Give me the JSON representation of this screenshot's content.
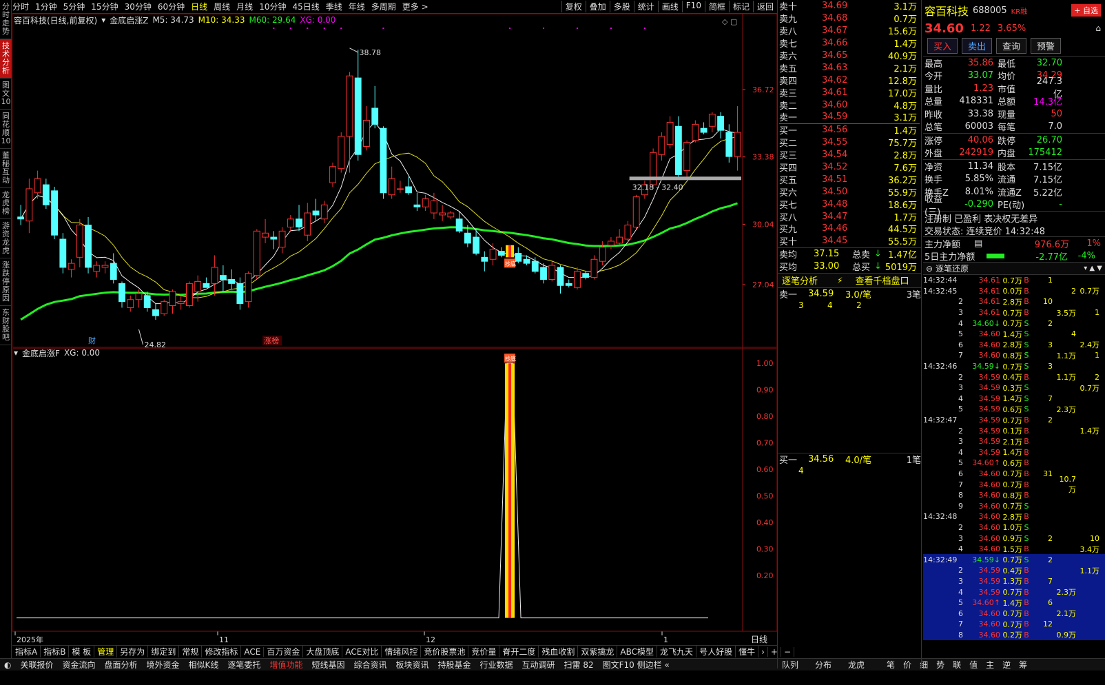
{
  "left_tabs": [
    "分时走势",
    "技术分析",
    "图文10",
    "同花顺10",
    "董秘互动",
    "龙虎榜",
    "游资龙虎",
    "涨跌停原因",
    "东财股吧"
  ],
  "top_periods": [
    "分时",
    "1分钟",
    "5分钟",
    "15分钟",
    "30分钟",
    "60分钟",
    "日线",
    "周线",
    "月线",
    "10分钟",
    "45日线",
    "季线",
    "年线",
    "多周期",
    "更多 >"
  ],
  "top_active": "日线",
  "top_right": [
    "复权",
    "叠加",
    "多股",
    "统计",
    "画线",
    "F10",
    "简框",
    "标记",
    "返回"
  ],
  "title": {
    "stock": "容百科技(日线,前复权)",
    "ind": "金底启涨Z",
    "m5": "M5: 34.73",
    "m10": "M10: 34.33",
    "m60": "M60: 29.64",
    "xg": "XG: 0.00"
  },
  "sub_title": {
    "ind": "金底启涨F",
    "xg": "XG: 0.00"
  },
  "chart_labels": {
    "high": "38.78",
    "low": "24.82",
    "range": "32.18 - 32.40",
    "cai": "财",
    "zhangbang": "涨榜",
    "signal": "抄底"
  },
  "price_axis": [
    "36.72",
    "33.38",
    "30.04",
    "27.04"
  ],
  "sub_axis": [
    "1.00",
    "0.90",
    "0.80",
    "0.70",
    "0.60",
    "0.50",
    "0.40",
    "0.30",
    "0.20"
  ],
  "x_axis": [
    "2025年",
    "11",
    "12",
    "1"
  ],
  "x_axis_right": "日线",
  "bottom_tabs": [
    "指标A",
    "指标B",
    "模 板",
    "管理",
    "另存为",
    "绑定到",
    "常规",
    "修改指标",
    "ACE",
    "百万资金",
    "大盘顶底",
    "ACE对比",
    "情绪风控",
    "竞价股票池",
    "竞价量",
    "脊开二度",
    "残血收割",
    "双紫擒龙",
    "ABC模型",
    "龙飞九天",
    "号人好股",
    "懂牛"
  ],
  "bottom_tabs_active": "管理",
  "status_bar": [
    "关联报价",
    "资金流向",
    "盘面分析",
    "境外资金",
    "相似K线",
    "逐笔委托",
    "增值功能",
    "短线基因",
    "综合资讯",
    "板块资讯",
    "持股基金",
    "行业数据",
    "互动调研",
    "扫雷 82",
    "图文F10 侧边栏 «"
  ],
  "status_bar_red": "增值功能",
  "right_tabs": [
    "队列",
    "分布",
    "龙虎",
    "笔",
    "价",
    "细",
    "势",
    "联",
    "值",
    "主",
    "逆",
    "筹"
  ],
  "orderbook": {
    "sells": [
      [
        "卖十",
        "34.69",
        "3.1万"
      ],
      [
        "卖九",
        "34.68",
        "0.7万"
      ],
      [
        "卖八",
        "34.67",
        "15.6万"
      ],
      [
        "卖七",
        "34.66",
        "1.4万"
      ],
      [
        "卖六",
        "34.65",
        "40.9万"
      ],
      [
        "卖五",
        "34.63",
        "2.1万"
      ],
      [
        "卖四",
        "34.62",
        "12.8万"
      ],
      [
        "卖三",
        "34.61",
        "17.0万"
      ],
      [
        "卖二",
        "34.60",
        "4.8万"
      ],
      [
        "卖一",
        "34.59",
        "3.1万"
      ]
    ],
    "buys": [
      [
        "买一",
        "34.56",
        "1.4万"
      ],
      [
        "买二",
        "34.55",
        "75.7万"
      ],
      [
        "买三",
        "34.54",
        "2.8万"
      ],
      [
        "买四",
        "34.52",
        "7.6万"
      ],
      [
        "买五",
        "34.51",
        "36.2万"
      ],
      [
        "买六",
        "34.50",
        "55.9万"
      ],
      [
        "买七",
        "34.48",
        "18.6万"
      ],
      [
        "买八",
        "34.47",
        "1.7万"
      ],
      [
        "买九",
        "34.46",
        "44.5万"
      ],
      [
        "买十",
        "34.45",
        "55.5万"
      ]
    ],
    "sell_avg": {
      "label": "卖均",
      "price": "37.15",
      "tlabel": "总卖",
      "tval": "1.47亿"
    },
    "buy_avg": {
      "label": "买均",
      "price": "33.00",
      "tlabel": "总买",
      "tval": "5019万"
    },
    "ana_title": "逐笔分析",
    "ana_link": "查看千档盘口",
    "s1": {
      "label": "卖一",
      "price": "34.59",
      "per": "3.0/笔",
      "cnt": "3笔",
      "items": [
        "3",
        "4",
        "2"
      ]
    },
    "b1": {
      "label": "买一",
      "price": "34.56",
      "per": "4.0/笔",
      "cnt": "1笔",
      "items": [
        "4"
      ]
    }
  },
  "stock": {
    "name": "容百科技",
    "code": "688005",
    "tag": "KR融",
    "fav": "+ 自选",
    "price": "34.60",
    "chg": "1.22",
    "pct": "3.65%"
  },
  "actions": [
    "买入",
    "卖出",
    "查询",
    "预警"
  ],
  "stats": [
    [
      "最高",
      "35.86",
      "最低",
      "32.70"
    ],
    [
      "今开",
      "33.07",
      "均价",
      "34.29"
    ],
    [
      "量比",
      "1.23",
      "市值",
      "247.3亿"
    ],
    [
      "总量",
      "418331",
      "总额",
      "14.3亿"
    ],
    [
      "昨收",
      "33.38",
      "现量",
      "50"
    ],
    [
      "总笔",
      "60003",
      "每笔",
      "7.0"
    ]
  ],
  "stats2": [
    [
      "涨停",
      "40.06",
      "跌停",
      "26.70"
    ],
    [
      "外盘",
      "242919",
      "内盘",
      "175412"
    ]
  ],
  "stats3": [
    [
      "净资",
      "11.34",
      "股本",
      "7.15亿"
    ],
    [
      "换手",
      "5.85%",
      "流通",
      "7.15亿"
    ],
    [
      "换手Z",
      "8.01%",
      "流通Z",
      "5.22亿"
    ],
    [
      "收益(三)",
      "-0.290",
      "PE(动)",
      "-"
    ]
  ],
  "reg_line": "注册制 已盈利 表决权无差异",
  "trade_state": "交易状态: 连续竞价 14:32:48",
  "main_net": {
    "label": "主力净额",
    "val": "976.6万",
    "pct": "1%"
  },
  "main_net5": {
    "label": "5日主力净额",
    "val": "-2.77亿",
    "pct": "-4%"
  },
  "ticks_title": "逐笔还原",
  "ticks": [
    [
      "14:32:44",
      "34.61",
      "0.7万",
      "B",
      "1",
      "",
      ""
    ],
    [
      "14:32:45",
      "34.61",
      "0.0万",
      "B",
      "",
      "2",
      "0.7万"
    ],
    [
      "2",
      "34.61",
      "2.8万",
      "B",
      "10",
      "",
      ""
    ],
    [
      "3",
      "34.61",
      "0.7万",
      "B",
      "",
      "3.5万",
      "1"
    ],
    [
      "4",
      "34.60↓",
      "0.7万",
      "S",
      "2",
      "",
      ""
    ],
    [
      "5",
      "34.60",
      "1.4万",
      "S",
      "",
      "4",
      ""
    ],
    [
      "6",
      "34.60",
      "2.8万",
      "S",
      "3",
      "",
      "2.4万"
    ],
    [
      "7",
      "34.60",
      "0.8万",
      "S",
      "",
      "1.1万",
      "1"
    ],
    [
      "14:32:46",
      "34.59↓",
      "0.7万",
      "S",
      "3",
      "",
      ""
    ],
    [
      "2",
      "34.59",
      "0.4万",
      "B",
      "",
      "1.1万",
      "2"
    ],
    [
      "3",
      "34.59",
      "0.3万",
      "S",
      "",
      "",
      "0.7万"
    ],
    [
      "4",
      "34.59",
      "1.4万",
      "S",
      "7",
      "",
      ""
    ],
    [
      "5",
      "34.59",
      "0.6万",
      "S",
      "",
      "2.3万",
      ""
    ],
    [
      "14:32:47",
      "34.59",
      "0.7万",
      "B",
      "2",
      "",
      ""
    ],
    [
      "2",
      "34.59",
      "0.1万",
      "B",
      "",
      "",
      "1.4万"
    ],
    [
      "3",
      "34.59",
      "2.1万",
      "B",
      "",
      "",
      ""
    ],
    [
      "4",
      "34.59",
      "1.4万",
      "B",
      "",
      "",
      ""
    ],
    [
      "5",
      "34.60↑",
      "0.6万",
      "B",
      "",
      "",
      ""
    ],
    [
      "6",
      "34.60",
      "0.7万",
      "B",
      "31",
      "",
      ""
    ],
    [
      "7",
      "34.60",
      "0.7万",
      "B",
      "",
      "10.7万",
      ""
    ],
    [
      "8",
      "34.60",
      "0.8万",
      "B",
      "",
      "",
      ""
    ],
    [
      "9",
      "34.60",
      "0.7万",
      "S",
      "",
      "",
      ""
    ],
    [
      "14:32:48",
      "34.60",
      "2.8万",
      "B",
      "",
      "",
      ""
    ],
    [
      "2",
      "34.60",
      "1.0万",
      "S",
      "",
      "",
      ""
    ],
    [
      "3",
      "34.60",
      "0.9万",
      "S",
      "2",
      "",
      "10"
    ],
    [
      "4",
      "34.60",
      "1.5万",
      "B",
      "",
      "",
      "3.4万"
    ],
    [
      "14:32:49",
      "34.59↓",
      "0.7万",
      "S",
      "2",
      "",
      ""
    ],
    [
      "2",
      "34.59",
      "0.4万",
      "B",
      "",
      "",
      "1.1万"
    ],
    [
      "3",
      "34.59",
      "1.3万",
      "B",
      "7",
      "",
      ""
    ],
    [
      "4",
      "34.59",
      "0.7万",
      "B",
      "",
      "2.3万",
      ""
    ],
    [
      "5",
      "34.60↑",
      "1.4万",
      "B",
      "6",
      "",
      ""
    ],
    [
      "6",
      "34.60",
      "0.7万",
      "B",
      "",
      "2.1万",
      ""
    ],
    [
      "7",
      "34.60",
      "0.7万",
      "B",
      "12",
      "",
      ""
    ],
    [
      "8",
      "34.60",
      "0.2万",
      "B",
      "",
      "0.9万",
      ""
    ]
  ],
  "ticks_highlight_from": 26,
  "chart_data": {
    "type": "candlestick",
    "ylim": [
      24.0,
      39.8
    ],
    "candles": [
      [
        30.4,
        31.0,
        30.0,
        30.3
      ],
      [
        30.2,
        32.3,
        29.6,
        31.8
      ],
      [
        31.6,
        32.7,
        31.3,
        32.3
      ],
      [
        32.0,
        32.3,
        30.8,
        31.0
      ],
      [
        31.7,
        31.9,
        29.3,
        29.5
      ],
      [
        29.3,
        29.6,
        27.6,
        27.9
      ],
      [
        27.8,
        28.3,
        27.4,
        28.1
      ],
      [
        28.4,
        30.3,
        27.9,
        30.0
      ],
      [
        30.0,
        30.4,
        27.6,
        27.9
      ],
      [
        27.7,
        28.2,
        27.4,
        28.0
      ],
      [
        27.9,
        28.2,
        27.6,
        28.0
      ],
      [
        28.1,
        28.6,
        27.1,
        27.3
      ],
      [
        27.1,
        27.2,
        25.9,
        26.2
      ],
      [
        25.9,
        26.5,
        25.7,
        26.3
      ],
      [
        26.3,
        26.8,
        25.9,
        26.6
      ],
      [
        26.5,
        26.7,
        25.7,
        25.9
      ],
      [
        25.8,
        26.1,
        25.3,
        25.5
      ],
      [
        25.6,
        26.3,
        25.5,
        26.2
      ],
      [
        26.0,
        26.8,
        25.6,
        26.7
      ],
      [
        26.1,
        26.5,
        25.8,
        26.2
      ],
      [
        26.0,
        27.2,
        25.9,
        27.1
      ],
      [
        26.7,
        27.5,
        26.2,
        27.2
      ],
      [
        27.1,
        27.4,
        26.9,
        26.9
      ],
      [
        27.1,
        28.5,
        26.5,
        27.9
      ],
      [
        27.5,
        28.0,
        26.7,
        27.3
      ],
      [
        27.3,
        27.8,
        26.8,
        27.1
      ],
      [
        27.1,
        27.4,
        25.8,
        26.1
      ],
      [
        26.2,
        27.7,
        25.9,
        27.6
      ],
      [
        27.5,
        29.8,
        27.3,
        29.7
      ],
      [
        29.4,
        30.3,
        29.1,
        29.6
      ],
      [
        29.4,
        29.7,
        28.8,
        29.3
      ],
      [
        28.9,
        29.9,
        28.6,
        29.7
      ],
      [
        29.9,
        30.5,
        29.7,
        30.3
      ],
      [
        30.3,
        31.0,
        29.7,
        29.9
      ],
      [
        29.5,
        31.1,
        29.2,
        30.6
      ],
      [
        30.7,
        31.3,
        30.2,
        30.5
      ],
      [
        30.3,
        31.2,
        30.1,
        31.0
      ],
      [
        32.1,
        33.1,
        31.9,
        32.9
      ],
      [
        32.8,
        34.6,
        32.6,
        34.4
      ],
      [
        34.4,
        37.6,
        32.6,
        37.4
      ],
      [
        37.3,
        38.7,
        33.2,
        33.5
      ],
      [
        33.9,
        35.9,
        33.7,
        35.2
      ],
      [
        35.8,
        36.9,
        34.8,
        35.0
      ],
      [
        34.8,
        34.9,
        31.3,
        31.6
      ],
      [
        31.5,
        32.9,
        31.3,
        32.3
      ],
      [
        31.8,
        32.2,
        31.6,
        31.8
      ],
      [
        31.9,
        32.4,
        31.5,
        31.6
      ],
      [
        31.0,
        31.6,
        30.7,
        30.9
      ],
      [
        30.9,
        31.5,
        30.7,
        31.3
      ],
      [
        30.6,
        31.6,
        30.3,
        31.2
      ],
      [
        30.5,
        31.0,
        30.2,
        30.6
      ],
      [
        30.4,
        30.7,
        30.3,
        30.6
      ],
      [
        30.3,
        30.7,
        29.6,
        29.7
      ],
      [
        29.6,
        30.0,
        28.9,
        29.1
      ],
      [
        29.4,
        29.8,
        28.5,
        28.6
      ],
      [
        28.4,
        28.7,
        27.7,
        28.2
      ],
      [
        28.3,
        29.1,
        28.0,
        28.8
      ],
      [
        28.7,
        28.9,
        28.4,
        28.5
      ],
      [
        28.8,
        29.0,
        28.4,
        28.7
      ],
      [
        28.6,
        28.9,
        28.1,
        28.2
      ],
      [
        28.3,
        28.5,
        28.0,
        28.1
      ],
      [
        28.2,
        28.4,
        27.6,
        27.7
      ],
      [
        27.9,
        28.1,
        27.1,
        27.3
      ],
      [
        27.3,
        28.2,
        27.2,
        28.0
      ],
      [
        27.9,
        28.0,
        26.6,
        27.0
      ],
      [
        27.1,
        27.3,
        26.9,
        27.0
      ],
      [
        26.9,
        27.9,
        26.8,
        27.7
      ],
      [
        27.6,
        27.7,
        27.3,
        27.4
      ],
      [
        27.4,
        28.5,
        27.3,
        28.3
      ],
      [
        28.2,
        29.2,
        28.0,
        28.9
      ],
      [
        29.0,
        29.4,
        28.8,
        29.2
      ],
      [
        29.1,
        29.8,
        29.0,
        29.4
      ],
      [
        29.3,
        30.2,
        29.0,
        30.0
      ],
      [
        29.9,
        31.5,
        29.8,
        31.4
      ],
      [
        31.5,
        32.2,
        31.3,
        32.0
      ],
      [
        32.0,
        33.8,
        31.8,
        33.6
      ],
      [
        33.5,
        34.6,
        33.2,
        34.4
      ],
      [
        34.0,
        35.4,
        33.8,
        35.1
      ],
      [
        34.9,
        35.4,
        32.4,
        32.5
      ],
      [
        32.7,
        34.2,
        32.4,
        34.1
      ],
      [
        34.2,
        35.2,
        34.1,
        35.0
      ],
      [
        34.8,
        35.1,
        34.5,
        34.6
      ],
      [
        34.9,
        35.6,
        34.6,
        35.5
      ],
      [
        35.4,
        35.6,
        34.3,
        34.7
      ],
      [
        34.6,
        35.0,
        33.1,
        33.4
      ],
      [
        33.4,
        35.9,
        32.7,
        34.6
      ]
    ],
    "signal_index": 58,
    "high": {
      "index": 39,
      "value": 38.78
    },
    "low": {
      "index": 14,
      "value": 24.82
    },
    "range_label": "32.18 - 32.40",
    "sub_ylim": [
      0,
      1.05
    ]
  }
}
